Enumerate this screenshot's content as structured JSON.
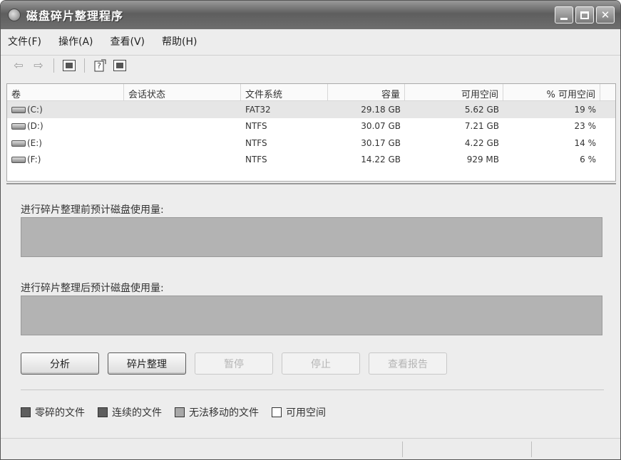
{
  "window": {
    "title": "磁盘碎片整理程序"
  },
  "menu": [
    {
      "label": "文件(F)"
    },
    {
      "label": "操作(A)"
    },
    {
      "label": "查看(V)"
    },
    {
      "label": "帮助(H)"
    }
  ],
  "toolbar": {
    "back_glyph": "⇦",
    "forward_glyph": "⇨",
    "icons": [
      "back-arrow-icon",
      "forward-arrow-icon",
      "console-tree-icon",
      "help-icon",
      "properties-icon"
    ]
  },
  "list": {
    "columns": [
      "卷",
      "会话状态",
      "文件系统",
      "容量",
      "可用空间",
      "% 可用空间"
    ],
    "rows": [
      {
        "volume": "(C:)",
        "session": "",
        "fs": "FAT32",
        "capacity": "29.18 GB",
        "free": "5.62 GB",
        "pct": "19 %"
      },
      {
        "volume": "(D:)",
        "session": "",
        "fs": "NTFS",
        "capacity": "30.07 GB",
        "free": "7.21 GB",
        "pct": "23 %"
      },
      {
        "volume": "(E:)",
        "session": "",
        "fs": "NTFS",
        "capacity": "30.17 GB",
        "free": "4.22 GB",
        "pct": "14 %"
      },
      {
        "volume": "(F:)",
        "session": "",
        "fs": "NTFS",
        "capacity": "14.22 GB",
        "free": "929 MB",
        "pct": "6 %"
      }
    ]
  },
  "before_label": "进行碎片整理前预计磁盘使用量:",
  "after_label": "进行碎片整理后预计磁盘使用量:",
  "buttons": {
    "analyze": "分析",
    "defrag": "碎片整理",
    "pause": "暂停",
    "stop": "停止",
    "report": "查看报告"
  },
  "legend": [
    {
      "label": "零碎的文件",
      "color": "#5e5e5e"
    },
    {
      "label": "连续的文件",
      "color": "#5e5e5e"
    },
    {
      "label": "无法移动的文件",
      "color": "#a8a8a8"
    },
    {
      "label": "可用空间",
      "color": "#ffffff"
    }
  ]
}
